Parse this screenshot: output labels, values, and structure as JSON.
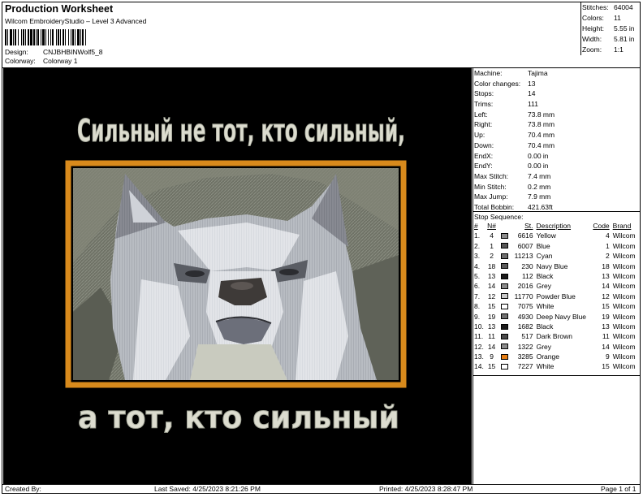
{
  "header": {
    "title": "Production Worksheet",
    "subtitle": "Wilcom  EmbroideryStudio – Level 3 Advanced",
    "design_label": "Design:",
    "design_value": "CNJBHBINWolf5_8",
    "colorway_label": "Colorway:",
    "colorway_value": "Colorway 1"
  },
  "stats": [
    {
      "label": "Stitches:",
      "value": "64004"
    },
    {
      "label": "Colors:",
      "value": "11"
    },
    {
      "label": "Height:",
      "value": "5.55 in"
    },
    {
      "label": "Width:",
      "value": "5.81 in"
    },
    {
      "label": "Zoom:",
      "value": "1:1"
    }
  ],
  "design": {
    "top_text": "Сильный не тот, кто сильный,",
    "bottom_text": "а тот, кто сильный",
    "frame_color": "#d88a1c",
    "text_color": "#dcdccf"
  },
  "machine_info": [
    {
      "label": "Machine:",
      "value": "Tajima"
    },
    {
      "label": "Color changes:",
      "value": "13"
    },
    {
      "label": "Stops:",
      "value": "14"
    },
    {
      "label": "Trims:",
      "value": "111"
    },
    {
      "label": "Left:",
      "value": "73.8 mm"
    },
    {
      "label": "Right:",
      "value": "73.8 mm"
    },
    {
      "label": "Up:",
      "value": "70.4 mm"
    },
    {
      "label": "Down:",
      "value": "70.4 mm"
    },
    {
      "label": "EndX:",
      "value": "0.00 in"
    },
    {
      "label": "EndY:",
      "value": "0.00 in"
    },
    {
      "label": "Max Stitch:",
      "value": "7.4 mm"
    },
    {
      "label": "Min Stitch:",
      "value": "0.2 mm"
    },
    {
      "label": "Max Jump:",
      "value": "7.9 mm"
    },
    {
      "label": "Total Bobbin:",
      "value": "421.63ft"
    }
  ],
  "stop_sequence": {
    "title": "Stop Sequence:",
    "headers": {
      "num": "#",
      "n": "N#",
      "st": "St.",
      "description": "Description",
      "code": "Code",
      "brand": "Brand"
    },
    "rows": [
      {
        "num": "1.",
        "n": "4",
        "color": "#8c8c8c",
        "st": "6616",
        "description": "Yellow",
        "code": "4",
        "brand": "Wilcom"
      },
      {
        "num": "2.",
        "n": "1",
        "color": "#555555",
        "st": "6007",
        "description": "Blue",
        "code": "1",
        "brand": "Wilcom"
      },
      {
        "num": "3.",
        "n": "2",
        "color": "#6e6e6e",
        "st": "11213",
        "description": "Cyan",
        "code": "2",
        "brand": "Wilcom"
      },
      {
        "num": "4.",
        "n": "18",
        "color": "#5a5a5a",
        "st": "230",
        "description": "Navy Blue",
        "code": "18",
        "brand": "Wilcom"
      },
      {
        "num": "5.",
        "n": "13",
        "color": "#1a1a1a",
        "st": "112",
        "description": "Black",
        "code": "13",
        "brand": "Wilcom"
      },
      {
        "num": "6.",
        "n": "14",
        "color": "#8a8a8a",
        "st": "2016",
        "description": "Grey",
        "code": "14",
        "brand": "Wilcom"
      },
      {
        "num": "7.",
        "n": "12",
        "color": "#c8c8c8",
        "st": "11770",
        "description": "Powder Blue",
        "code": "12",
        "brand": "Wilcom"
      },
      {
        "num": "8.",
        "n": "15",
        "color": "#ffffff",
        "st": "7075",
        "description": "White",
        "code": "15",
        "brand": "Wilcom"
      },
      {
        "num": "9.",
        "n": "19",
        "color": "#707070",
        "st": "4930",
        "description": "Deep Navy Blue",
        "code": "19",
        "brand": "Wilcom"
      },
      {
        "num": "10.",
        "n": "13",
        "color": "#1a1a1a",
        "st": "1682",
        "description": "Black",
        "code": "13",
        "brand": "Wilcom"
      },
      {
        "num": "11.",
        "n": "11",
        "color": "#4a4a4a",
        "st": "517",
        "description": "Dark Brown",
        "code": "11",
        "brand": "Wilcom"
      },
      {
        "num": "12.",
        "n": "14",
        "color": "#8a8a8a",
        "st": "1322",
        "description": "Grey",
        "code": "14",
        "brand": "Wilcom"
      },
      {
        "num": "13.",
        "n": "9",
        "color": "#e67e14",
        "st": "3285",
        "description": "Orange",
        "code": "9",
        "brand": "Wilcom"
      },
      {
        "num": "14.",
        "n": "15",
        "color": "#ffffff",
        "st": "7227",
        "description": "White",
        "code": "15",
        "brand": "Wilcom"
      }
    ]
  },
  "footer": {
    "created_by": "Created By:",
    "last_saved": "Last Saved: 4/25/2023 8:21:26 PM",
    "printed": "Printed: 4/25/2023 8:28:47 PM",
    "page": "Page 1 of 1"
  }
}
